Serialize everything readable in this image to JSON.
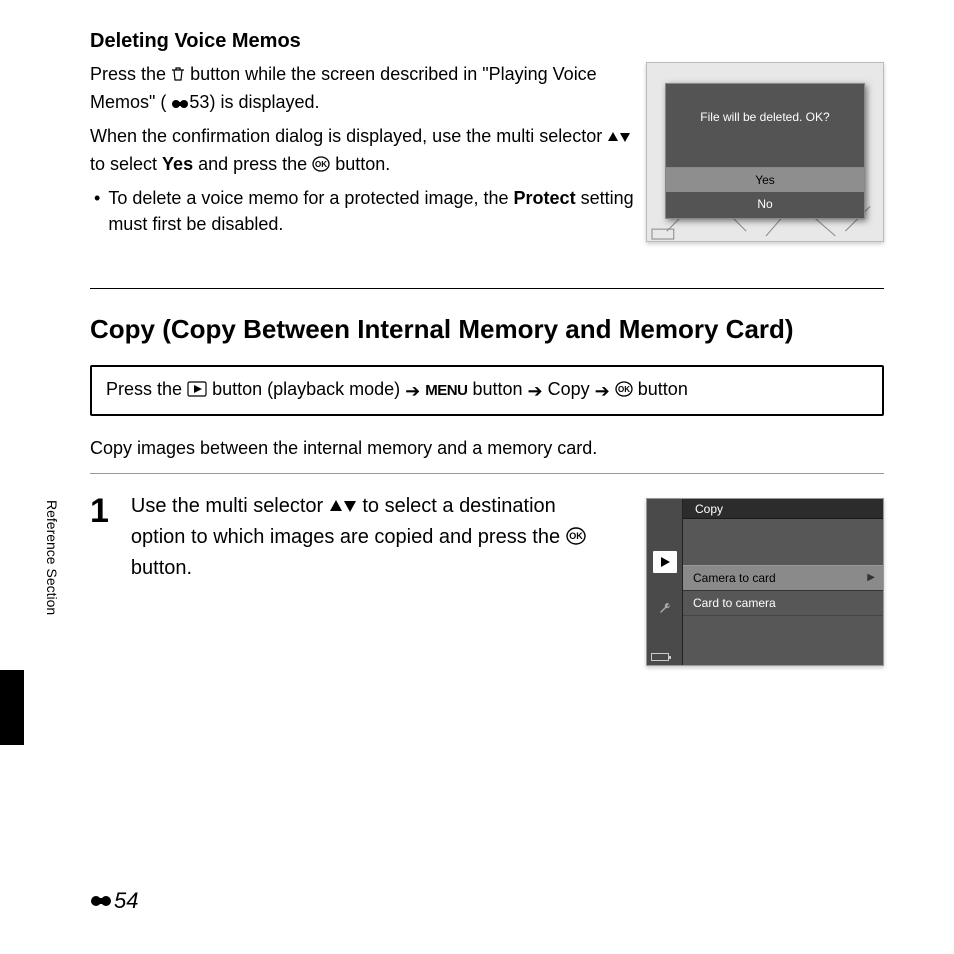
{
  "section1": {
    "title": "Deleting Voice Memos",
    "p1a": "Press the ",
    "p1b": " button while the screen described in \"Playing Voice Memos\" (",
    "p1c": "53) is displayed.",
    "p2a": "When the confirmation dialog is displayed, use the multi selector ",
    "p2b": " to select ",
    "p2_yes": "Yes",
    "p2c": " and press the ",
    "p2d": " button.",
    "bullet_a": "To delete a voice memo for a protected image, the ",
    "bullet_bold": "Protect",
    "bullet_b": " setting must first be disabled."
  },
  "shot1": {
    "message": "File will be deleted. OK?",
    "yes": "Yes",
    "no": "No"
  },
  "section2": {
    "title": "Copy (Copy Between Internal Memory and Memory Card)",
    "nav_a": "Press the ",
    "nav_b": " button (playback mode) ",
    "nav_menu": "MENU",
    "nav_c": " button ",
    "nav_d": " Copy ",
    "nav_e": " button",
    "intro": "Copy images between the internal memory and a memory card.",
    "step_num": "1",
    "step_a": "Use the multi selector ",
    "step_b": " to select a destination option to which images are copied and press the ",
    "step_c": " button."
  },
  "shot2": {
    "title": "Copy",
    "item_selected": "Camera to card",
    "item2": "Card to camera"
  },
  "sidebar": "Reference Section",
  "page_num": "54"
}
